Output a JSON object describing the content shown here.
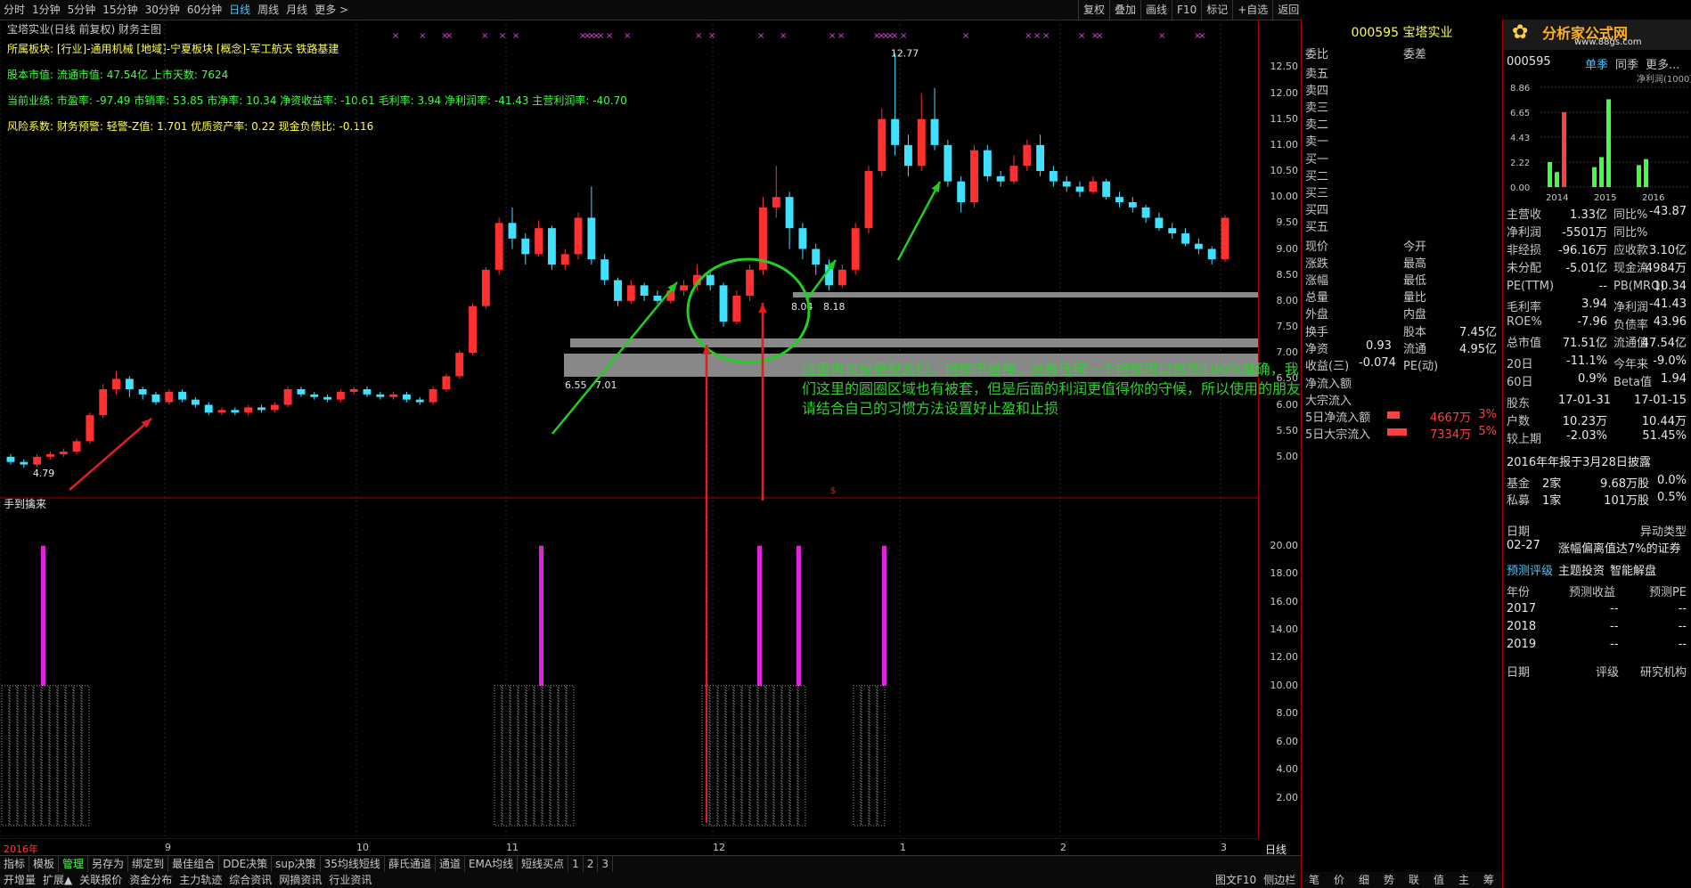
{
  "toolbar": {
    "periods": [
      "分时",
      "1分钟",
      "5分钟",
      "15分钟",
      "30分钟",
      "60分钟",
      "日线",
      "周线",
      "月线",
      "更多 >"
    ],
    "active_period": "日线",
    "right_buttons": [
      "复权",
      "叠加",
      "画线",
      "F10",
      "标记",
      "+自选",
      "返回"
    ]
  },
  "chart": {
    "title": "宝塔实业(日线 前复权) 财务主图",
    "info_lines": [
      "所属板块: [行业]-通用机械 [地域]-宁夏板块 [概念]-军工航天 铁路基建",
      "股本市值: 流通市值: 47.54亿 上市天数: 7624",
      "当前业绩: 市盈率: -97.49 市销率: 53.85 市净率: 10.34 净资收益率: -10.61 毛利率: 3.94 净利润率: -41.43 主营利润率: -40.70",
      "风险系数: 财务预警: 轻警-Z值: 1.701 优质资产率: 0.22 现金负债比: -0.116"
    ],
    "price_ticks": [
      "12.50",
      "12.00",
      "11.50",
      "11.00",
      "10.50",
      "10.00",
      "9.50",
      "9.00",
      "8.50",
      "8.00",
      "7.50",
      "7.00",
      "6.50",
      "6.00",
      "5.50",
      "5.00"
    ],
    "price_labels": {
      "high": "12.77",
      "low": "4.79",
      "mid1": "6.55",
      "mid2": "7.01",
      "mid3": "8.04",
      "mid4": "8.18"
    },
    "annotation": "这里再次提醒股友们，指标不是神，没有任何一个指标可以做到100%准确，我们这里的圆圈区域也有被套，但是后面的利润更值得你的守候，所以使用的朋友请结合自己的习惯方法设置好止盈和止损",
    "indicator_title": "手到擒来",
    "indicator_ticks": [
      "20.00",
      "18.00",
      "16.00",
      "14.00",
      "12.00",
      "10.00",
      "8.00",
      "6.00",
      "4.00",
      "2.00"
    ],
    "x_labels": [
      "2016年",
      "9",
      "10",
      "11",
      "12",
      "1",
      "2",
      "3"
    ],
    "period_label": "日线"
  },
  "chart_data": {
    "type": "candlestick",
    "ylim": [
      4.5,
      12.9
    ],
    "candles": [
      [
        5.0,
        4.9,
        5.05,
        4.85
      ],
      [
        4.9,
        4.85,
        4.95,
        4.79
      ],
      [
        4.85,
        5.0,
        5.05,
        4.8
      ],
      [
        5.0,
        5.05,
        5.1,
        4.95
      ],
      [
        5.05,
        5.1,
        5.15,
        5.0
      ],
      [
        5.1,
        5.3,
        5.35,
        5.05
      ],
      [
        5.3,
        5.8,
        5.85,
        5.25
      ],
      [
        5.8,
        6.3,
        6.4,
        5.75
      ],
      [
        6.3,
        6.5,
        6.65,
        6.2
      ],
      [
        6.5,
        6.3,
        6.55,
        6.15
      ],
      [
        6.3,
        6.2,
        6.35,
        6.1
      ],
      [
        6.2,
        6.05,
        6.25,
        6.0
      ],
      [
        6.05,
        6.25,
        6.3,
        6.0
      ],
      [
        6.25,
        6.1,
        6.3,
        6.05
      ],
      [
        6.1,
        6.0,
        6.15,
        5.95
      ],
      [
        6.0,
        5.85,
        6.05,
        5.8
      ],
      [
        5.85,
        5.9,
        5.95,
        5.8
      ],
      [
        5.9,
        5.85,
        5.95,
        5.8
      ],
      [
        5.85,
        5.95,
        6.0,
        5.8
      ],
      [
        5.95,
        5.9,
        6.0,
        5.85
      ],
      [
        5.9,
        6.0,
        6.05,
        5.85
      ],
      [
        6.0,
        6.3,
        6.35,
        5.95
      ],
      [
        6.3,
        6.2,
        6.35,
        6.15
      ],
      [
        6.2,
        6.15,
        6.25,
        6.1
      ],
      [
        6.15,
        6.1,
        6.2,
        6.05
      ],
      [
        6.1,
        6.25,
        6.3,
        6.05
      ],
      [
        6.25,
        6.3,
        6.35,
        6.2
      ],
      [
        6.3,
        6.2,
        6.35,
        6.15
      ],
      [
        6.2,
        6.15,
        6.25,
        6.1
      ],
      [
        6.15,
        6.2,
        6.25,
        6.1
      ],
      [
        6.2,
        6.1,
        6.25,
        6.05
      ],
      [
        6.1,
        6.05,
        6.15,
        6.0
      ],
      [
        6.05,
        6.3,
        6.35,
        6.0
      ],
      [
        6.3,
        6.55,
        6.6,
        6.25
      ],
      [
        6.55,
        7.0,
        7.05,
        6.5
      ],
      [
        7.0,
        7.9,
        7.95,
        6.95
      ],
      [
        7.9,
        8.6,
        8.65,
        7.85
      ],
      [
        8.6,
        9.5,
        9.6,
        8.5
      ],
      [
        9.5,
        9.2,
        9.8,
        9.0
      ],
      [
        9.2,
        8.9,
        9.3,
        8.7
      ],
      [
        8.9,
        9.4,
        9.55,
        8.85
      ],
      [
        9.4,
        8.7,
        9.45,
        8.6
      ],
      [
        8.7,
        8.9,
        9.0,
        8.6
      ],
      [
        8.9,
        9.6,
        9.7,
        8.8
      ],
      [
        9.6,
        8.8,
        10.2,
        8.7
      ],
      [
        8.8,
        8.4,
        8.9,
        8.3
      ],
      [
        8.4,
        8.0,
        8.45,
        7.9
      ],
      [
        8.0,
        8.3,
        8.4,
        7.95
      ],
      [
        8.3,
        8.1,
        8.35,
        8.0
      ],
      [
        8.1,
        8.0,
        8.2,
        7.95
      ],
      [
        8.0,
        8.2,
        8.3,
        7.95
      ],
      [
        8.2,
        8.3,
        8.4,
        8.1
      ],
      [
        8.3,
        8.5,
        8.7,
        8.2
      ],
      [
        8.5,
        8.3,
        8.55,
        8.2
      ],
      [
        8.3,
        7.6,
        8.35,
        7.5
      ],
      [
        7.6,
        8.1,
        8.2,
        7.55
      ],
      [
        8.1,
        8.6,
        8.7,
        8.0
      ],
      [
        8.6,
        9.8,
        10.0,
        8.5
      ],
      [
        9.8,
        10.0,
        10.6,
        9.6
      ],
      [
        10.0,
        9.4,
        10.1,
        9.0
      ],
      [
        9.4,
        9.0,
        9.5,
        8.8
      ],
      [
        9.0,
        8.7,
        9.1,
        8.5
      ],
      [
        8.7,
        8.3,
        8.8,
        8.2
      ],
      [
        8.3,
        8.6,
        8.7,
        8.25
      ],
      [
        8.6,
        9.4,
        9.5,
        8.5
      ],
      [
        9.4,
        10.5,
        10.6,
        9.3
      ],
      [
        10.5,
        11.5,
        11.7,
        10.4
      ],
      [
        11.5,
        11.0,
        12.77,
        10.8
      ],
      [
        11.0,
        10.6,
        11.2,
        10.4
      ],
      [
        10.6,
        11.5,
        12.0,
        10.5
      ],
      [
        11.5,
        11.0,
        12.1,
        10.9
      ],
      [
        11.0,
        10.3,
        11.1,
        10.2
      ],
      [
        10.3,
        9.9,
        10.4,
        9.7
      ],
      [
        9.9,
        10.9,
        11.0,
        9.8
      ],
      [
        10.9,
        10.4,
        11.0,
        10.3
      ],
      [
        10.4,
        10.3,
        10.5,
        10.2
      ],
      [
        10.3,
        10.6,
        10.8,
        10.25
      ],
      [
        10.6,
        11.0,
        11.1,
        10.5
      ],
      [
        11.0,
        10.5,
        11.2,
        10.4
      ],
      [
        10.5,
        10.3,
        10.6,
        10.2
      ],
      [
        10.3,
        10.2,
        10.4,
        10.1
      ],
      [
        10.2,
        10.1,
        10.3,
        10.0
      ],
      [
        10.1,
        10.3,
        10.4,
        10.05
      ],
      [
        10.3,
        10.0,
        10.35,
        9.95
      ],
      [
        10.0,
        9.9,
        10.1,
        9.8
      ],
      [
        9.9,
        9.8,
        10.0,
        9.7
      ],
      [
        9.8,
        9.6,
        9.85,
        9.5
      ],
      [
        9.6,
        9.4,
        9.7,
        9.35
      ],
      [
        9.4,
        9.3,
        9.5,
        9.2
      ],
      [
        9.3,
        9.1,
        9.4,
        9.05
      ],
      [
        9.1,
        9.0,
        9.2,
        8.9
      ],
      [
        9.0,
        8.8,
        9.05,
        8.7
      ],
      [
        8.8,
        9.6,
        9.65,
        8.75
      ]
    ],
    "signals": [
      1,
      33,
      57,
      60,
      66
    ],
    "signal_value": 20
  },
  "quote_panel": {
    "code": "000595",
    "name": "宝塔实业",
    "header_left": "委比",
    "header_right": "委差",
    "sells": [
      "卖五",
      "卖四",
      "卖三",
      "卖二",
      "卖一"
    ],
    "buys": [
      "买一",
      "买二",
      "买三",
      "买四",
      "买五"
    ],
    "stats_left": [
      "现价",
      "涨跌",
      "涨幅",
      "总量",
      "外盘"
    ],
    "stats_right": [
      "今开",
      "最高",
      "最低",
      "量比",
      "内盘"
    ],
    "turnover_label": "换手",
    "capital_label": "股本",
    "capital_value": "7.45亿",
    "net_assets_label": "净资",
    "net_assets_value": "0.93",
    "float_label": "流通",
    "float_value": "4.95亿",
    "eps_label": "收益(三)",
    "eps_value": "-0.074",
    "pe_label": "PE(动)",
    "flow_in_label": "净流入额",
    "big_in_label": "大宗流入",
    "five_day_net_label": "5日净流入额",
    "five_day_net_value": "4667万",
    "five_day_net_pct": "3%",
    "five_day_big_label": "5日大宗流入",
    "five_day_big_value": "7334万",
    "five_day_big_pct": "5%"
  },
  "right_panel": {
    "logo_text": "分析家公式网",
    "logo_url": "www.88gs.com",
    "code": "000595",
    "tabs": [
      "单季",
      "同季",
      "更多..."
    ],
    "chart_unit": "净利润(1000万)",
    "chart_ticks": [
      "8.86",
      "6.65",
      "4.43",
      "2.22",
      "0.00"
    ],
    "chart_years": [
      "2014",
      "2015",
      "2016"
    ],
    "fin_rows": [
      [
        "主营收",
        "1.33亿",
        "同比%",
        "-43.87"
      ],
      [
        "净利润",
        "-5501万",
        "同比%",
        ""
      ],
      [
        "非经损",
        "-96.16万",
        "应收款",
        "3.10亿"
      ],
      [
        "未分配",
        "-5.01亿",
        "现金流",
        "-4984万"
      ],
      [
        "PE(TTM)",
        "--",
        "PB(MRQ)",
        "10.34"
      ],
      [
        "毛利率",
        "3.94",
        "净利润",
        "-41.43"
      ],
      [
        "ROE%",
        "-7.96",
        "负债率",
        "43.96"
      ],
      [
        "总市值",
        "71.51亿",
        "流通值",
        "47.54亿"
      ],
      [
        "20日",
        "-11.1%",
        "今年来",
        "-9.0%"
      ],
      [
        "60日",
        "0.9%",
        "Beta值",
        "1.94"
      ],
      [
        "股东",
        "17-01-31",
        "",
        "17-01-15"
      ],
      [
        "户数",
        "10.23万",
        "",
        "10.44万"
      ],
      [
        "较上期",
        "-2.03%",
        "",
        "51.45%"
      ]
    ],
    "report_note": "2016年年报于3月28日披露",
    "fund_rows": [
      [
        "基金",
        "2家",
        "9.68万股",
        "0.0%"
      ],
      [
        "私募",
        "1家",
        "101万股",
        "0.5%"
      ]
    ],
    "date_label": "日期",
    "abnormal_label": "异动类型",
    "abnormal_date": "02-27",
    "abnormal_desc": "涨幅偏离值达7%的证券",
    "forecast_tabs": [
      "预测评级",
      "主题投资",
      "智能解盘"
    ],
    "forecast_header": [
      "年份",
      "预测收益",
      "预测PE"
    ],
    "forecast_rows": [
      [
        "2017",
        "--",
        "--"
      ],
      [
        "2018",
        "--",
        "--"
      ],
      [
        "2019",
        "--",
        "--"
      ]
    ],
    "rating_header": [
      "日期",
      "评级",
      "研究机构"
    ]
  },
  "bottom": {
    "row1": [
      "指标",
      "模板",
      "管理",
      "另存为",
      "绑定到",
      "最佳组合",
      "DDE决策",
      "sup决策",
      "35均线短线",
      "薛氏通道",
      "通道",
      "EMA均线",
      "短线买点",
      "1",
      "2",
      "3"
    ],
    "row2": [
      "开增量",
      "扩展▲",
      "关联报价",
      "资金分布",
      "主力轨迹",
      "综合资讯",
      "网摘资讯",
      "行业资讯"
    ],
    "right_tabs": [
      "图文F10",
      "侧边栏"
    ],
    "panel_tabs": [
      "笔",
      "价",
      "细",
      "势",
      "联",
      "值",
      "主",
      "筹"
    ]
  }
}
